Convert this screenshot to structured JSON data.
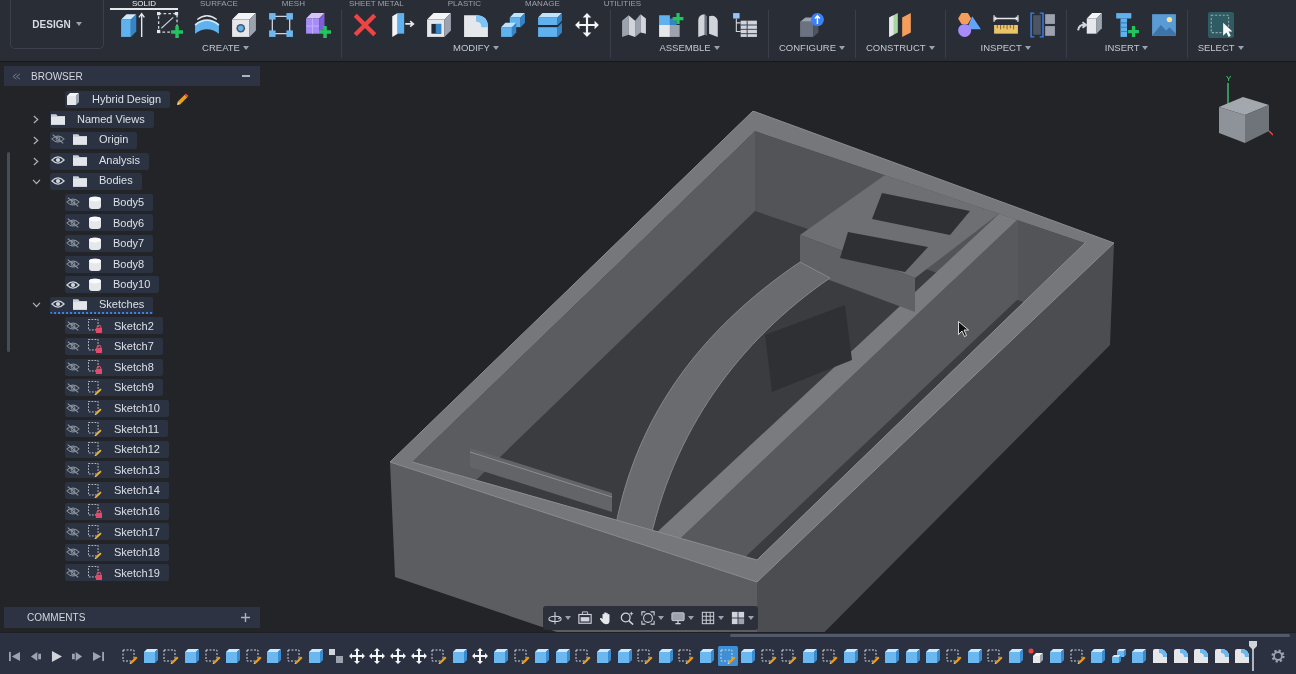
{
  "toolbar": {
    "workspace": "DESIGN",
    "tabs": [
      {
        "label": "SOLID",
        "selected": true
      },
      {
        "label": "SURFACE",
        "selected": false
      },
      {
        "label": "MESH",
        "selected": false
      },
      {
        "label": "SHEET METAL",
        "selected": false
      },
      {
        "label": "PLASTIC",
        "selected": false
      },
      {
        "label": "MANAGE",
        "selected": false
      },
      {
        "label": "UTILITIES",
        "selected": false
      }
    ],
    "groups": [
      {
        "label": "CREATE",
        "tools": [
          {
            "kind": "extrude"
          },
          {
            "kind": "sketch"
          },
          {
            "kind": "revolve"
          },
          {
            "kind": "hole"
          },
          {
            "kind": "pattern"
          },
          {
            "kind": "form"
          }
        ]
      },
      {
        "label": "MODIFY",
        "tools": [
          {
            "kind": "delete"
          },
          {
            "kind": "presspull"
          },
          {
            "kind": "shell"
          },
          {
            "kind": "fillet"
          },
          {
            "kind": "combine"
          },
          {
            "kind": "split"
          },
          {
            "kind": "move"
          }
        ]
      },
      {
        "label": "ASSEMBLE",
        "tools": [
          {
            "kind": "joint"
          },
          {
            "kind": "component"
          },
          {
            "kind": "asbuilt"
          },
          {
            "kind": "table"
          }
        ]
      },
      {
        "label": "CONFIGURE",
        "tools": [
          {
            "kind": "configure"
          }
        ]
      },
      {
        "label": "CONSTRUCT",
        "tools": [
          {
            "kind": "plane"
          }
        ]
      },
      {
        "label": "INSPECT",
        "tools": [
          {
            "kind": "analysis"
          },
          {
            "kind": "measure"
          },
          {
            "kind": "section"
          }
        ]
      },
      {
        "label": "INSERT",
        "tools": [
          {
            "kind": "insert"
          },
          {
            "kind": "fastener"
          },
          {
            "kind": "canvas"
          }
        ]
      },
      {
        "label": "SELECT",
        "tools": [
          {
            "kind": "select"
          }
        ]
      }
    ]
  },
  "browser": {
    "title": "BROWSER",
    "root": {
      "label": "Hybrid Design",
      "kind": "design",
      "active": true,
      "children": [
        {
          "label": "Named Views",
          "kind": "folder",
          "expanded": false,
          "highlighted": false
        },
        {
          "label": "Origin",
          "kind": "folder",
          "expanded": false,
          "visible": false,
          "highlighted": false
        },
        {
          "label": "Analysis",
          "kind": "folder",
          "expanded": false,
          "visible": true,
          "highlighted": false
        },
        {
          "label": "Bodies",
          "kind": "folder",
          "expanded": true,
          "visible": true,
          "highlighted": false,
          "children": [
            {
              "label": "Body5",
              "kind": "body",
              "visible": false
            },
            {
              "label": "Body6",
              "kind": "body",
              "visible": false
            },
            {
              "label": "Body7",
              "kind": "body",
              "visible": false
            },
            {
              "label": "Body8",
              "kind": "body",
              "visible": false
            },
            {
              "label": "Body10",
              "kind": "body",
              "visible": true
            }
          ]
        },
        {
          "label": "Sketches",
          "kind": "folder",
          "expanded": true,
          "visible": true,
          "highlighted": true,
          "children": [
            {
              "label": "Sketch2",
              "kind": "sketch",
              "visible": false,
              "locked": true
            },
            {
              "label": "Sketch7",
              "kind": "sketch",
              "visible": false,
              "locked": true
            },
            {
              "label": "Sketch8",
              "kind": "sketch",
              "visible": false,
              "locked": true
            },
            {
              "label": "Sketch9",
              "kind": "sketch",
              "visible": false,
              "locked": false
            },
            {
              "label": "Sketch10",
              "kind": "sketch",
              "visible": false,
              "locked": false
            },
            {
              "label": "Sketch11",
              "kind": "sketch",
              "visible": false,
              "locked": false
            },
            {
              "label": "Sketch12",
              "kind": "sketch",
              "visible": false,
              "locked": false
            },
            {
              "label": "Sketch13",
              "kind": "sketch",
              "visible": false,
              "locked": false
            },
            {
              "label": "Sketch14",
              "kind": "sketch",
              "visible": false,
              "locked": false
            },
            {
              "label": "Sketch16",
              "kind": "sketch",
              "visible": false,
              "locked": true
            },
            {
              "label": "Sketch17",
              "kind": "sketch",
              "visible": false,
              "locked": false
            },
            {
              "label": "Sketch18",
              "kind": "sketch",
              "visible": false,
              "locked": false
            },
            {
              "label": "Sketch19",
              "kind": "sketch",
              "visible": false,
              "locked": true
            }
          ]
        }
      ]
    }
  },
  "view_cube": {
    "axis_label": "Y"
  },
  "comments": {
    "title": "COMMENTS"
  },
  "navigation_bar": {
    "tools": [
      {
        "kind": "orbit",
        "dropdown": true
      },
      {
        "kind": "look",
        "dropdown": false
      },
      {
        "kind": "pan",
        "dropdown": false
      },
      {
        "kind": "zoom",
        "dropdown": false
      },
      {
        "kind": "fit",
        "dropdown": true
      },
      {
        "kind": "display",
        "dropdown": true
      },
      {
        "kind": "grid",
        "dropdown": true
      },
      {
        "kind": "viewports",
        "dropdown": true
      }
    ]
  },
  "timeline": {
    "features": [
      {
        "kind": "sketch",
        "selected": false
      },
      {
        "kind": "extrude",
        "selected": false
      },
      {
        "kind": "sketch",
        "selected": false
      },
      {
        "kind": "extrude",
        "selected": false
      },
      {
        "kind": "sketch",
        "selected": false
      },
      {
        "kind": "extrude",
        "selected": false
      },
      {
        "kind": "sketch",
        "selected": false
      },
      {
        "kind": "extrude",
        "selected": false
      },
      {
        "kind": "sketch",
        "selected": false
      },
      {
        "kind": "extrude",
        "selected": false
      },
      {
        "kind": "component",
        "selected": false
      },
      {
        "kind": "move",
        "selected": false
      },
      {
        "kind": "move",
        "selected": false
      },
      {
        "kind": "move",
        "selected": false
      },
      {
        "kind": "move",
        "selected": false
      },
      {
        "kind": "sketch",
        "selected": false
      },
      {
        "kind": "extrude",
        "selected": false
      },
      {
        "kind": "move",
        "selected": false
      },
      {
        "kind": "extrude",
        "selected": false
      },
      {
        "kind": "sketch",
        "selected": false
      },
      {
        "kind": "extrude",
        "selected": false
      },
      {
        "kind": "extrude",
        "selected": false
      },
      {
        "kind": "sketch",
        "selected": false
      },
      {
        "kind": "extrude",
        "selected": false
      },
      {
        "kind": "extrude",
        "selected": false
      },
      {
        "kind": "sketch",
        "selected": false
      },
      {
        "kind": "extrude",
        "selected": false
      },
      {
        "kind": "sketch",
        "selected": false
      },
      {
        "kind": "extrude",
        "selected": false
      },
      {
        "kind": "sketch",
        "selected": true
      },
      {
        "kind": "extrude",
        "selected": false
      },
      {
        "kind": "sketch",
        "selected": false
      },
      {
        "kind": "sketch",
        "selected": false
      },
      {
        "kind": "extrude",
        "selected": false
      },
      {
        "kind": "sketch",
        "selected": false
      },
      {
        "kind": "extrude",
        "selected": false
      },
      {
        "kind": "sketch",
        "selected": false
      },
      {
        "kind": "extrude",
        "selected": false
      },
      {
        "kind": "extrude",
        "selected": false
      },
      {
        "kind": "extrude",
        "selected": false
      },
      {
        "kind": "sketch",
        "selected": false
      },
      {
        "kind": "extrude",
        "selected": false
      },
      {
        "kind": "sketch",
        "selected": false
      },
      {
        "kind": "extrude",
        "selected": false
      },
      {
        "kind": "body",
        "selected": false
      },
      {
        "kind": "extrude",
        "selected": false
      },
      {
        "kind": "sketch",
        "selected": false
      },
      {
        "kind": "extrude",
        "selected": false
      },
      {
        "kind": "combine",
        "selected": false
      },
      {
        "kind": "extrude",
        "selected": false
      },
      {
        "kind": "fillet",
        "selected": false
      },
      {
        "kind": "fillet",
        "selected": false
      },
      {
        "kind": "fillet",
        "selected": false
      },
      {
        "kind": "fillet",
        "selected": false
      },
      {
        "kind": "fillet",
        "selected": false
      }
    ]
  }
}
